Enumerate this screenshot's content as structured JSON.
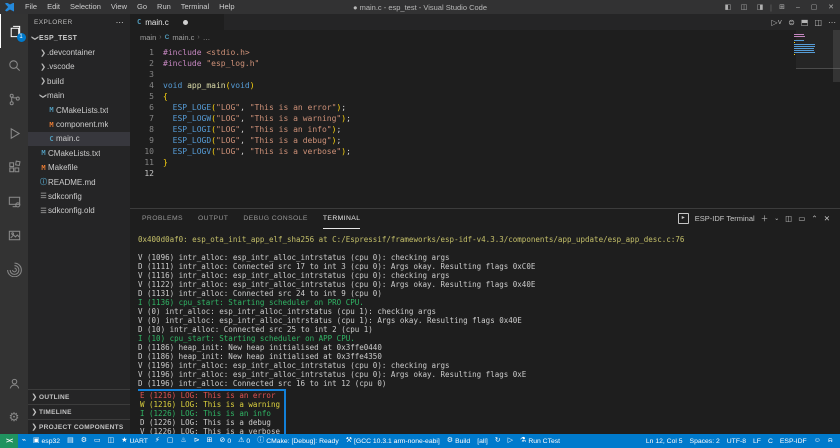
{
  "window": {
    "title": "● main.c - esp_test - Visual Studio Code",
    "menu": [
      "File",
      "Edit",
      "Selection",
      "View",
      "Go",
      "Run",
      "Terminal",
      "Help"
    ]
  },
  "activity_bar": {
    "explorer_badge": "1",
    "items": [
      "explorer",
      "search",
      "source-control",
      "run-and-debug",
      "extensions",
      "remote-explorer",
      "references",
      "esp-idf-explorer"
    ],
    "bottom_items": [
      "accounts",
      "settings"
    ]
  },
  "explorer": {
    "header": "EXPLORER",
    "header_more": "⋯",
    "tree": [
      {
        "indent": 0,
        "chev": "down",
        "label": "ESP_TEST",
        "root": true
      },
      {
        "indent": 1,
        "chev": "right",
        "label": ".devcontainer"
      },
      {
        "indent": 1,
        "chev": "right",
        "label": ".vscode"
      },
      {
        "indent": 1,
        "chev": "right",
        "label": "build"
      },
      {
        "indent": 1,
        "chev": "down",
        "label": "main"
      },
      {
        "indent": 2,
        "icon": "M",
        "icon_color": "#519aba",
        "label": "CMakeLists.txt"
      },
      {
        "indent": 2,
        "icon": "M",
        "icon_color": "#e37933",
        "label": "component.mk"
      },
      {
        "indent": 2,
        "icon": "C",
        "icon_color": "#519aba",
        "label": "main.c",
        "selected": true
      },
      {
        "indent": 1,
        "icon": "M",
        "icon_color": "#519aba",
        "label": "CMakeLists.txt"
      },
      {
        "indent": 1,
        "icon": "M",
        "icon_color": "#e37933",
        "label": "Makefile"
      },
      {
        "indent": 1,
        "icon": "ⓘ",
        "icon_color": "#519aba",
        "label": "README.md"
      },
      {
        "indent": 1,
        "icon": "☰",
        "icon_color": "#8a8a8a",
        "label": "sdkconfig"
      },
      {
        "indent": 1,
        "icon": "☰",
        "icon_color": "#8a8a8a",
        "label": "sdkconfig.old"
      }
    ],
    "bottom_sections": [
      "OUTLINE",
      "TIMELINE",
      "PROJECT COMPONENTS"
    ]
  },
  "editor": {
    "tab_label": "main.c",
    "breadcrumb": [
      "main",
      "main.c",
      "…"
    ],
    "code_lines": [
      [
        [
          "pp",
          "#include"
        ],
        [
          "pl",
          " "
        ],
        [
          "str",
          "<stdio.h>"
        ]
      ],
      [
        [
          "pp",
          "#include"
        ],
        [
          "pl",
          " "
        ],
        [
          "str",
          "\"esp_log.h\""
        ]
      ],
      [],
      [
        [
          "kw",
          "void"
        ],
        [
          "pl",
          " "
        ],
        [
          "fn",
          "app_main"
        ],
        [
          "b1",
          "("
        ],
        [
          "kw",
          "void"
        ],
        [
          "b1",
          ")"
        ]
      ],
      [
        [
          "b1",
          "{"
        ]
      ],
      [
        [
          "pl",
          "  "
        ],
        [
          "macro",
          "ESP_LOGE"
        ],
        [
          "b1",
          "("
        ],
        [
          "str",
          "\"LOG\""
        ],
        [
          "pl",
          ", "
        ],
        [
          "str",
          "\"This is an error\""
        ],
        [
          "b1",
          ")"
        ],
        [
          "pl",
          ";"
        ]
      ],
      [
        [
          "pl",
          "  "
        ],
        [
          "macro",
          "ESP_LOGW"
        ],
        [
          "b1",
          "("
        ],
        [
          "str",
          "\"LOG\""
        ],
        [
          "pl",
          ", "
        ],
        [
          "str",
          "\"This is a warning\""
        ],
        [
          "b1",
          ")"
        ],
        [
          "pl",
          ";"
        ]
      ],
      [
        [
          "pl",
          "  "
        ],
        [
          "macro",
          "ESP_LOGI"
        ],
        [
          "b1",
          "("
        ],
        [
          "str",
          "\"LOG\""
        ],
        [
          "pl",
          ", "
        ],
        [
          "str",
          "\"This is an info\""
        ],
        [
          "b1",
          ")"
        ],
        [
          "pl",
          ";"
        ]
      ],
      [
        [
          "pl",
          "  "
        ],
        [
          "macro",
          "ESP_LOGD"
        ],
        [
          "b1",
          "("
        ],
        [
          "str",
          "\"LOG\""
        ],
        [
          "pl",
          ", "
        ],
        [
          "str",
          "\"This is a debug\""
        ],
        [
          "b1",
          ")"
        ],
        [
          "pl",
          ";"
        ]
      ],
      [
        [
          "pl",
          "  "
        ],
        [
          "macro",
          "ESP_LOGV"
        ],
        [
          "b1",
          "("
        ],
        [
          "str",
          "\"LOG\""
        ],
        [
          "pl",
          ", "
        ],
        [
          "str",
          "\"This is a verbose\""
        ],
        [
          "b1",
          ")"
        ],
        [
          "pl",
          ";"
        ]
      ],
      [
        [
          "b1",
          "}"
        ]
      ],
      []
    ]
  },
  "panel": {
    "tabs": [
      "PROBLEMS",
      "OUTPUT",
      "DEBUG CONSOLE",
      "TERMINAL"
    ],
    "active_tab": "TERMINAL",
    "terminal_label": "ESP-IDF Terminal",
    "terminal": {
      "lines": [
        {
          "text": "0x400d0af0: esp_ota_init_app_elf_sha256 at C:/Espressif/frameworks/esp-idf-v4.3.3/components/app_update/esp_app_desc.c:76",
          "color": "yellow"
        },
        {
          "text": "",
          "color": "default"
        },
        {
          "text": "V (1096) intr_alloc: esp_intr_alloc_intrstatus (cpu 0): checking args",
          "color": "default"
        },
        {
          "text": "D (1111) intr_alloc: Connected src 17 to int 3 (cpu 0): Args okay. Resulting flags 0xC0E",
          "color": "default"
        },
        {
          "text": "V (1116) intr_alloc: esp_intr_alloc_intrstatus (cpu 0): checking args",
          "color": "default"
        },
        {
          "text": "V (1122) intr_alloc: esp_intr_alloc_intrstatus (cpu 0): Args okay. Resulting flags 0x40E",
          "color": "default"
        },
        {
          "text": "D (1131) intr_alloc: Connected src 24 to int 9 (cpu 0)",
          "color": "default"
        },
        {
          "text": "I (1136) cpu_start: Starting scheduler on PRO CPU.",
          "color": "green"
        },
        {
          "text": "V (0) intr_alloc: esp_intr_alloc_intrstatus (cpu 1): checking args",
          "color": "default"
        },
        {
          "text": "V (0) intr_alloc: esp_intr_alloc_intrstatus (cpu 1): Args okay. Resulting flags 0x40E",
          "color": "default"
        },
        {
          "text": "D (10) intr_alloc: Connected src 25 to int 2 (cpu 1)",
          "color": "default"
        },
        {
          "text": "I (10) cpu_start: Starting scheduler on APP CPU.",
          "color": "green"
        },
        {
          "text": "D (1186) heap_init: New heap initialised at 0x3ffe0440",
          "color": "default"
        },
        {
          "text": "D (1186) heap_init: New heap initialised at 0x3ffe4350",
          "color": "default"
        },
        {
          "text": "V (1196) intr_alloc: esp_intr_alloc_intrstatus (cpu 0): checking args",
          "color": "default"
        },
        {
          "text": "V (1196) intr_alloc: esp_intr_alloc_intrstatus (cpu 0): Args okay. Resulting flags 0xE",
          "color": "default"
        },
        {
          "text": "D (1196) intr_alloc: Connected src 16 to int 12 (cpu 0)",
          "color": "default"
        },
        {
          "text": "E (1216) LOG: This is an error",
          "color": "red",
          "boxed": true
        },
        {
          "text": "W (1216) LOG: This is a warning",
          "color": "warnyellow",
          "boxed": true
        },
        {
          "text": "I (1226) LOG: This is an info",
          "color": "green",
          "boxed": true
        },
        {
          "text": "D (1226) LOG: This is a debug",
          "color": "default",
          "boxed": true
        },
        {
          "text": "V (1226) LOG: This is a verbose",
          "color": "default",
          "boxed": true
        }
      ]
    }
  },
  "status_bar": {
    "remote_indicator": "><",
    "left": [
      {
        "icon": "plug",
        "name": "select-port"
      },
      {
        "icon": "board",
        "label": "esp32",
        "name": "device-target"
      },
      {
        "icon": "folder",
        "name": "select-project-folder"
      },
      {
        "icon": "gear",
        "name": "build-project"
      },
      {
        "icon": "trash",
        "name": "full-clean"
      },
      {
        "icon": "pkg",
        "name": "open-ota"
      },
      {
        "icon": "star",
        "label": "UART",
        "name": "flash-method"
      },
      {
        "icon": "bolt",
        "name": "flash-device"
      },
      {
        "icon": "monitor",
        "name": "monitor-device"
      },
      {
        "icon": "flame",
        "name": "build-flash-monitor"
      },
      {
        "icon": "termbox",
        "name": "open-esp-idf-terminal"
      },
      {
        "icon": "grid",
        "name": "execute-custom-task"
      },
      {
        "icon": "error",
        "label": "0",
        "name": "errors-count"
      },
      {
        "icon": "warn",
        "label": "0",
        "name": "warnings-count"
      },
      {
        "icon": "info",
        "label": "CMake: [Debug]: Ready",
        "name": "cmake-status"
      },
      {
        "icon": "wrench",
        "label": "[GCC 10.3.1 arm-none-eabi]",
        "name": "active-kit"
      },
      {
        "icon": "gear",
        "label": "Build",
        "name": "cmake-build"
      },
      {
        "label": "[all]",
        "name": "build-target"
      },
      {
        "icon": "refresh",
        "name": "cmake-refresh"
      },
      {
        "icon": "play",
        "name": "launch-debug-target"
      },
      {
        "icon": "flask",
        "label": "Run CTest",
        "name": "run-ctest"
      }
    ],
    "right": [
      {
        "label": "Ln 12, Col 5",
        "name": "cursor-position"
      },
      {
        "label": "Spaces: 2",
        "name": "indentation"
      },
      {
        "label": "UTF-8",
        "name": "encoding"
      },
      {
        "label": "LF",
        "name": "end-of-line"
      },
      {
        "label": "C",
        "name": "language-mode"
      },
      {
        "label": "ESP-IDF",
        "name": "esp-idf-version"
      },
      {
        "icon": "feedback",
        "name": "tweet-feedback"
      },
      {
        "icon": "bell",
        "name": "notifications"
      }
    ]
  },
  "colors": {
    "accent": "#007acc",
    "remote_green": "#20935f",
    "highlight_box_blue": "#1280d8",
    "terminal_green": "#30b565",
    "terminal_red": "#e05252",
    "terminal_yellow": "#c5c069",
    "terminal_warn_yellow": "#ddd23e"
  }
}
